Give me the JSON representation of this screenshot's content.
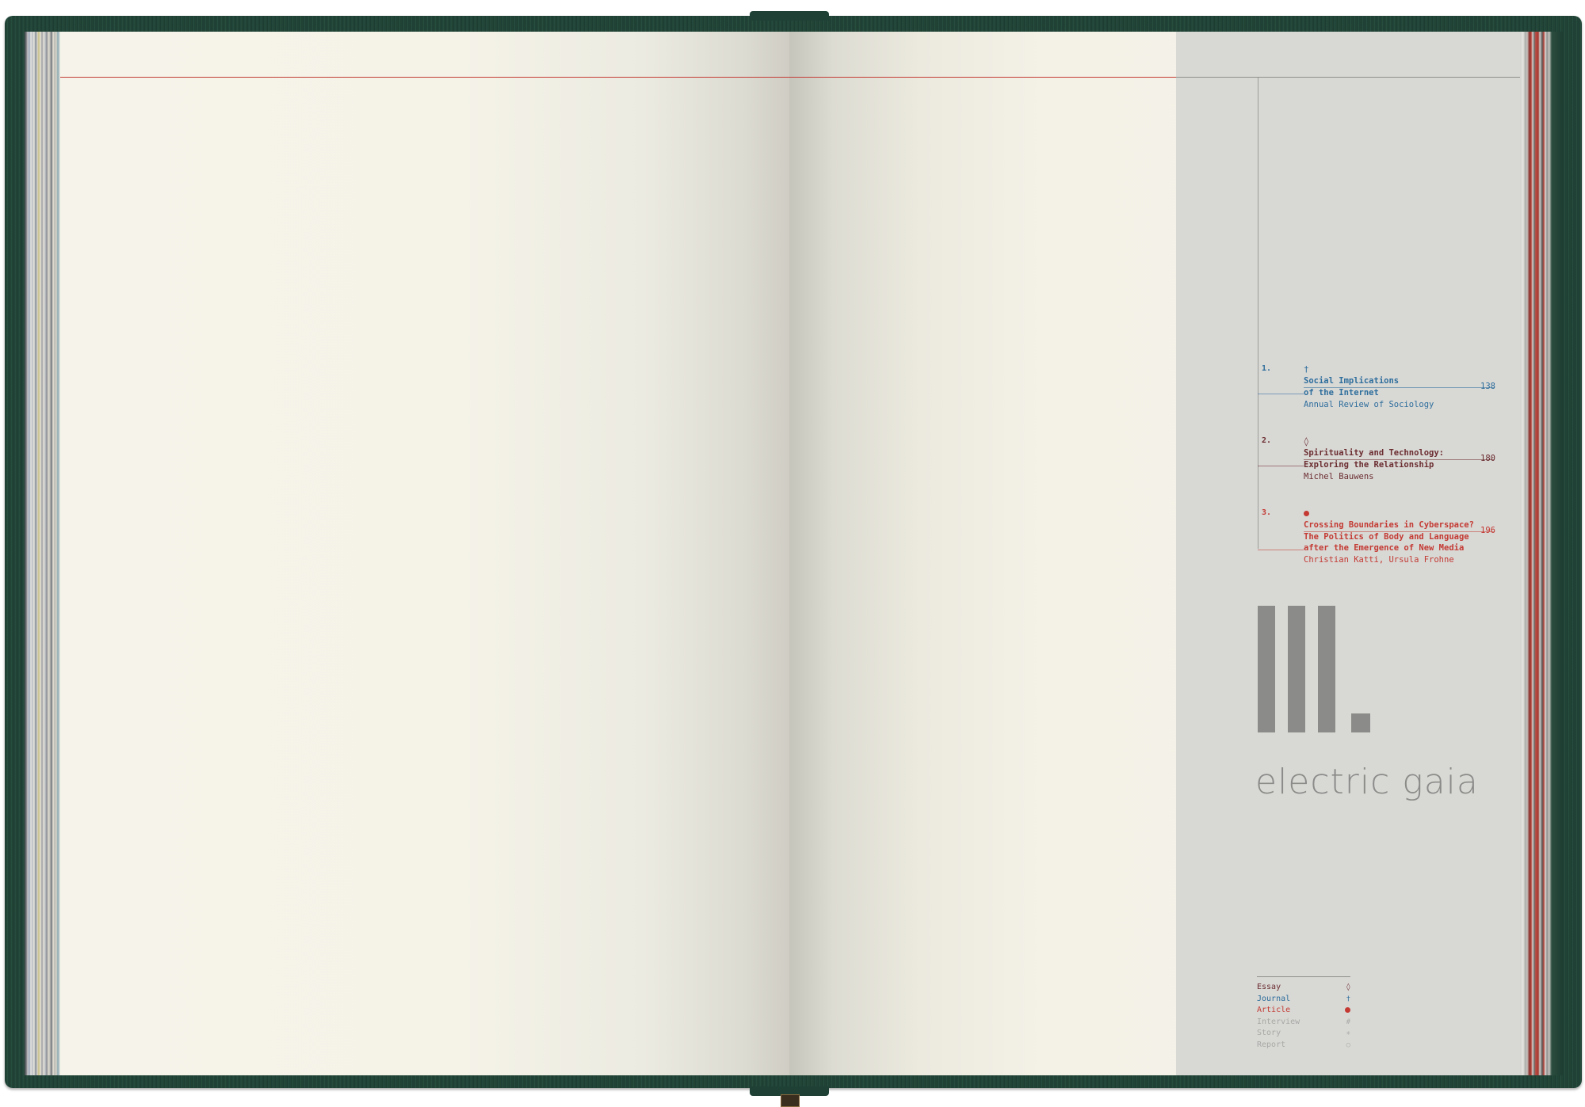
{
  "toc": [
    {
      "number": "1.",
      "marker": "†",
      "title_lines": [
        "Social Implications",
        "of the Internet"
      ],
      "author": "Annual Review of Sociology",
      "page": "138"
    },
    {
      "number": "2.",
      "marker": "◊",
      "title_lines": [
        "Spirituality and Technology:",
        "Exploring the Relationship"
      ],
      "author": "Michel Bauwens",
      "page": "180"
    },
    {
      "number": "3.",
      "marker": "●",
      "title_lines": [
        "Crossing Boundaries in Cyberspace?",
        "The Politics of Body and Language",
        "after the Emergence of New Media"
      ],
      "author": "Christian Katti, Ursula Frohne",
      "page": "196"
    }
  ],
  "section": {
    "wordmark": "electric gaia"
  },
  "legend": [
    {
      "label": "Essay",
      "symbol": "◊"
    },
    {
      "label": "Journal",
      "symbol": "†"
    },
    {
      "label": "Article",
      "symbol": "●"
    },
    {
      "label": "Interview",
      "symbol": "#"
    },
    {
      "label": "Story",
      "symbol": "✳"
    },
    {
      "label": "Report",
      "symbol": "○"
    }
  ],
  "colors": {
    "cover": "#1d3d31",
    "accent_red": "#c43a33",
    "journal_blue": "#2e6e9c",
    "essay_maroon": "#6b2d30",
    "panel_gray": "#d8d8d5",
    "numeral_gray": "#8b8b89"
  }
}
